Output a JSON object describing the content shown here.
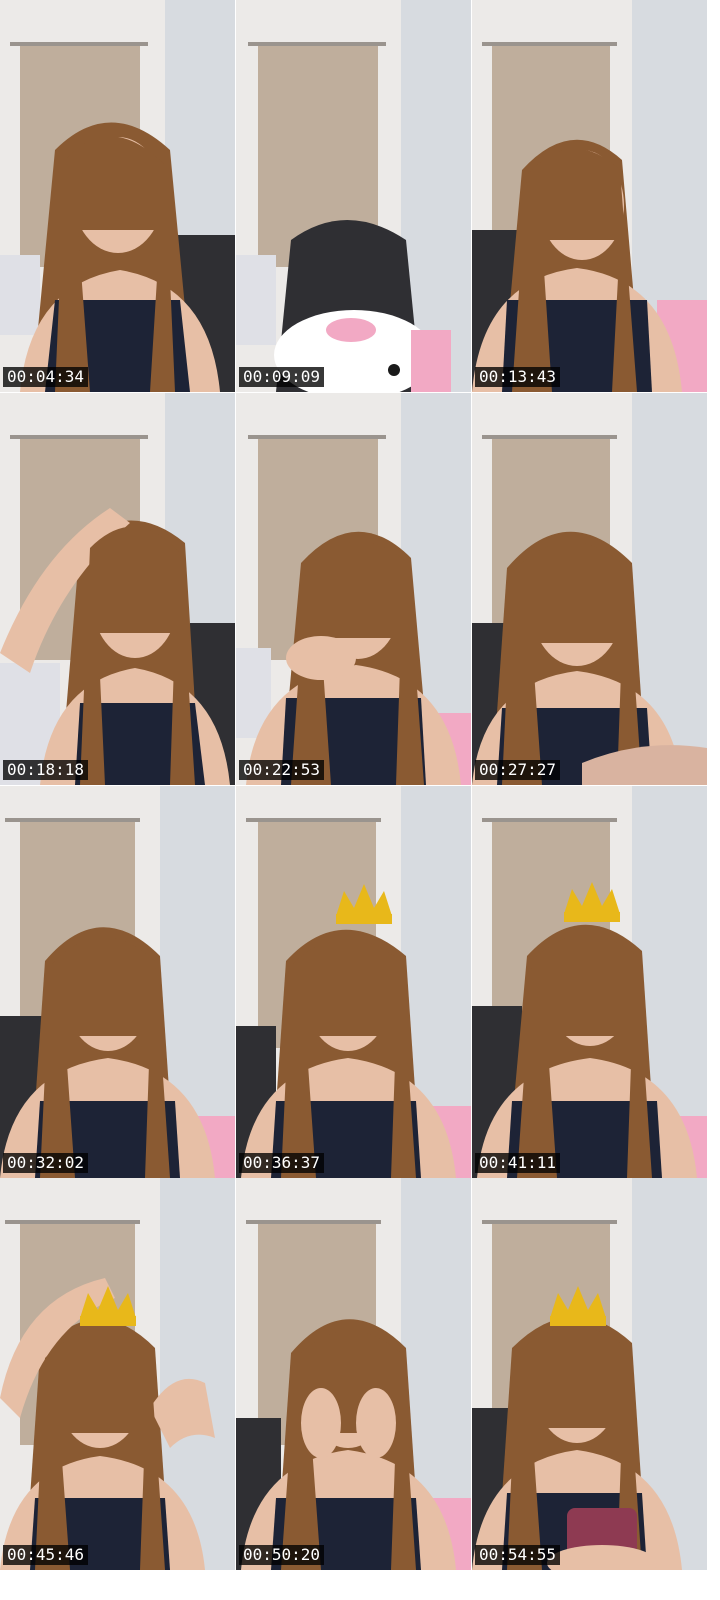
{
  "frames": [
    {
      "timestamp": "00:04:34"
    },
    {
      "timestamp": "00:09:09"
    },
    {
      "timestamp": "00:13:43"
    },
    {
      "timestamp": "00:18:18"
    },
    {
      "timestamp": "00:22:53"
    },
    {
      "timestamp": "00:27:27"
    },
    {
      "timestamp": "00:32:02"
    },
    {
      "timestamp": "00:36:37"
    },
    {
      "timestamp": "00:41:11"
    },
    {
      "timestamp": "00:45:46"
    },
    {
      "timestamp": "00:50:20"
    },
    {
      "timestamp": "00:54:55"
    }
  ],
  "colors": {
    "wall": "#eceae8",
    "curtain": "#bfae9c",
    "hair": "#8a5a32",
    "skin": "#e7bfa6",
    "top": "#1d2336",
    "chair": "#2f2f33",
    "crown": "#e8b81a",
    "timestamp_bg": "#000000"
  }
}
